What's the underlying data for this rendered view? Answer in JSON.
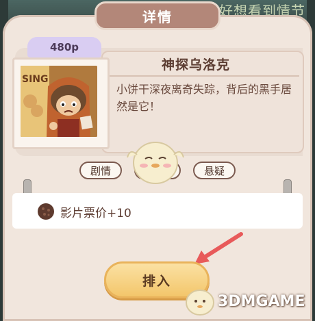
{
  "background_text": "好想看到情节",
  "dialog": {
    "title": "详情"
  },
  "movie": {
    "price": "480p",
    "title": "神探乌洛克",
    "description": "小饼干深夜离奇失踪，背后的黑手居然是它！",
    "poster_sign": "SING"
  },
  "tags": [
    "剧情",
    "动作",
    "悬疑"
  ],
  "reward": {
    "icon": "cookie-icon",
    "text": "影片票价+10"
  },
  "insert_button": {
    "label": "排入"
  },
  "watermark": {
    "text": "3DMGAME"
  },
  "colors": {
    "panel": "#f1e6dd",
    "title_tab": "#b38779",
    "price_badge": "#d9cdf2",
    "button": "#f3c66b",
    "arrow": "#e85a5a"
  }
}
